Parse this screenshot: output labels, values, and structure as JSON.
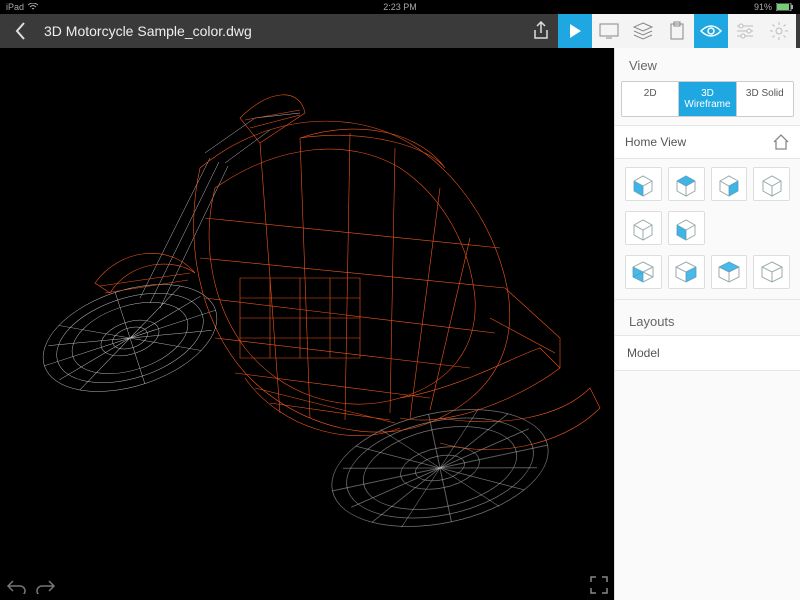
{
  "status": {
    "device": "iPad",
    "time": "2:23 PM",
    "battery_pct": "91%"
  },
  "header": {
    "title": "3D Motorcycle Sample_color.dwg"
  },
  "view_panel": {
    "title": "View",
    "modes": [
      "2D",
      "3D Wireframe",
      "3D Solid"
    ],
    "active_mode_index": 1,
    "home_view_label": "Home View",
    "layouts_title": "Layouts",
    "layouts": [
      "Model"
    ]
  },
  "colors": {
    "accent": "#1ea7e1",
    "wire_accent": "#ff5a1f",
    "wire_neutral": "#dcdcdc"
  }
}
